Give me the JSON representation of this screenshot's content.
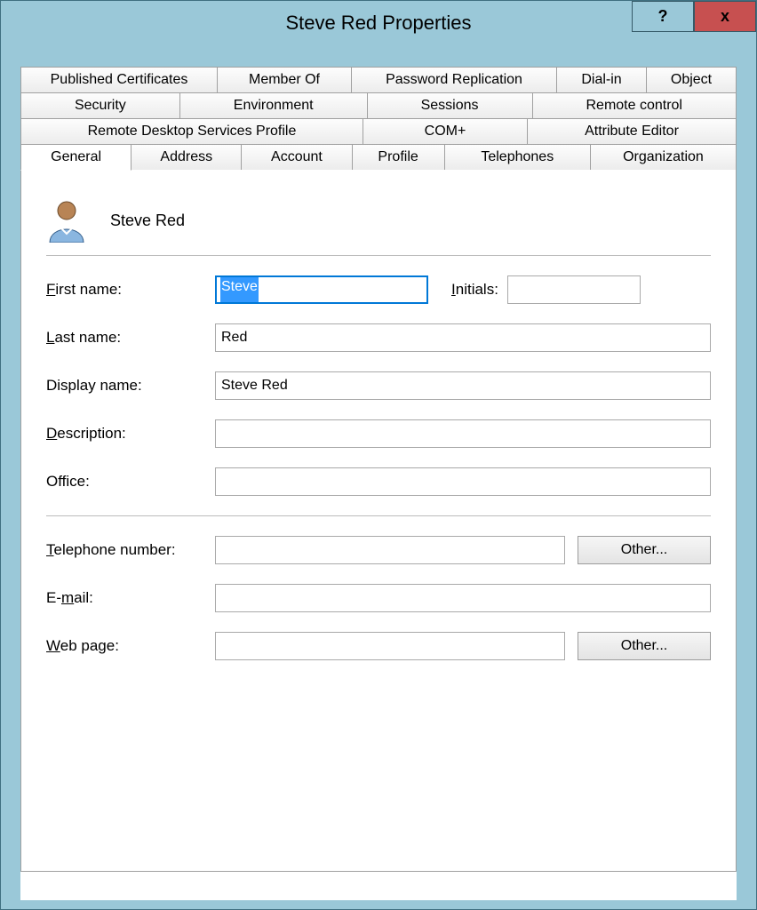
{
  "window": {
    "title": "Steve Red Properties"
  },
  "titleButtons": {
    "help": "?",
    "close": "x"
  },
  "tabs": {
    "row1": [
      "Published Certificates",
      "Member Of",
      "Password Replication",
      "Dial-in",
      "Object"
    ],
    "row2": [
      "Security",
      "Environment",
      "Sessions",
      "Remote control"
    ],
    "row3": [
      "Remote Desktop Services Profile",
      "COM+",
      "Attribute Editor"
    ],
    "row4": [
      "General",
      "Address",
      "Account",
      "Profile",
      "Telephones",
      "Organization"
    ],
    "active": "General"
  },
  "header": {
    "displayName": "Steve Red"
  },
  "labels": {
    "firstName": "First name:",
    "initials": "Initials:",
    "lastName": "Last name:",
    "displayName": "Display name:",
    "description": "Description:",
    "office": "Office:",
    "telephone": "Telephone number:",
    "email": "E-mail:",
    "webpage": "Web page:"
  },
  "values": {
    "firstName": "Steve",
    "initials": "",
    "lastName": "Red",
    "displayName": "Steve Red",
    "description": "",
    "office": "",
    "telephone": "",
    "email": "",
    "webpage": ""
  },
  "buttons": {
    "other": "Other..."
  },
  "underlines": {
    "firstName": "F",
    "initials": "I",
    "lastName": "L",
    "displayName": "",
    "description": "D",
    "office": "",
    "telephone": "T",
    "email": "m",
    "webpage": "W",
    "other": "O"
  }
}
